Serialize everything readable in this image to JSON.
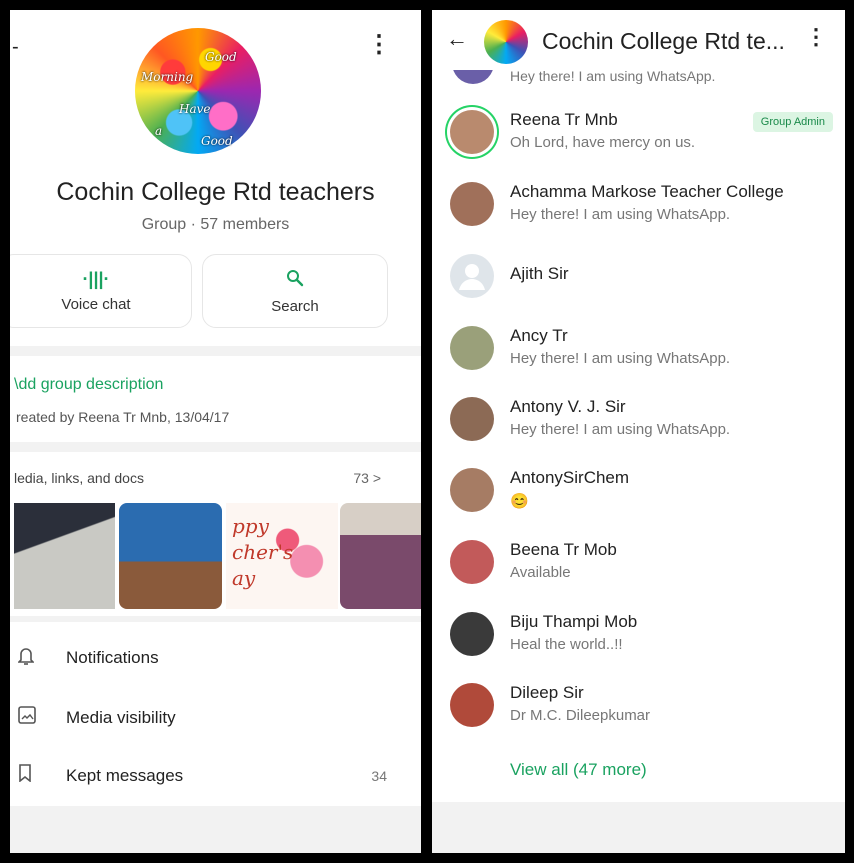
{
  "left": {
    "back_glyph": "←",
    "menu_glyph": "⋮",
    "avatar_words": [
      "Good",
      "Morning",
      "Have",
      "a",
      "Good"
    ],
    "title": "Cochin College  Rtd teachers",
    "subtitle": "Group · 57 members",
    "voice_chat_icon": "waveform-icon",
    "voice_chat_label": "Voice chat",
    "search_icon_glyph": "⚲",
    "search_label": "Search",
    "add_description": "\u0000dd group description",
    "created_by": "reated by Reena Tr Mnb, 13/04/17",
    "media_heading": "ledia, links, and docs",
    "media_count": "73  >",
    "media_thumb_text": "ppy\ncher's\nay",
    "menu": [
      {
        "icon": "bell-icon",
        "glyph": "🔔",
        "label": "Notifications",
        "count": ""
      },
      {
        "icon": "image-icon",
        "glyph": "🖼",
        "label": "Media visibility",
        "count": ""
      },
      {
        "icon": "bookmark-icon",
        "glyph": "🔖",
        "label": "Kept messages",
        "count": "34"
      }
    ]
  },
  "right": {
    "back_glyph": "←",
    "title": "Cochin College  Rtd te...",
    "menu_glyph": "⋮",
    "peek_status": "Hey there! I am using WhatsApp.",
    "members": [
      {
        "name": "Reena Tr Mnb",
        "status": "Oh Lord, have mercy on us.",
        "badge": "Group Admin",
        "color": "#b98a6e"
      },
      {
        "name": "Achamma Markose Teacher College",
        "status": "Hey there! I am using WhatsApp.",
        "badge": "",
        "color": "#a0705a"
      },
      {
        "name": "Ajith Sir",
        "status": "",
        "badge": "",
        "color": "#dfe5ea"
      },
      {
        "name": "Ancy Tr",
        "status": "Hey there! I am using WhatsApp.",
        "badge": "",
        "color": "#9aa07a"
      },
      {
        "name": "Antony V. J. Sir",
        "status": "Hey there! I am using WhatsApp.",
        "badge": "",
        "color": "#8c6a55"
      },
      {
        "name": "AntonySirChem",
        "status": "😊",
        "badge": "",
        "color": "#a67c64"
      },
      {
        "name": "Beena Tr Mob",
        "status": "Available",
        "badge": "",
        "color": "#c25a5a"
      },
      {
        "name": "Biju Thampi Mob",
        "status": "Heal the world..!!",
        "badge": "",
        "color": "#3a3a3a"
      },
      {
        "name": "Dileep Sir",
        "status": "Dr M.C. Dileepkumar",
        "badge": "",
        "color": "#b04a3a"
      }
    ],
    "view_all": "View all (47 more)"
  }
}
